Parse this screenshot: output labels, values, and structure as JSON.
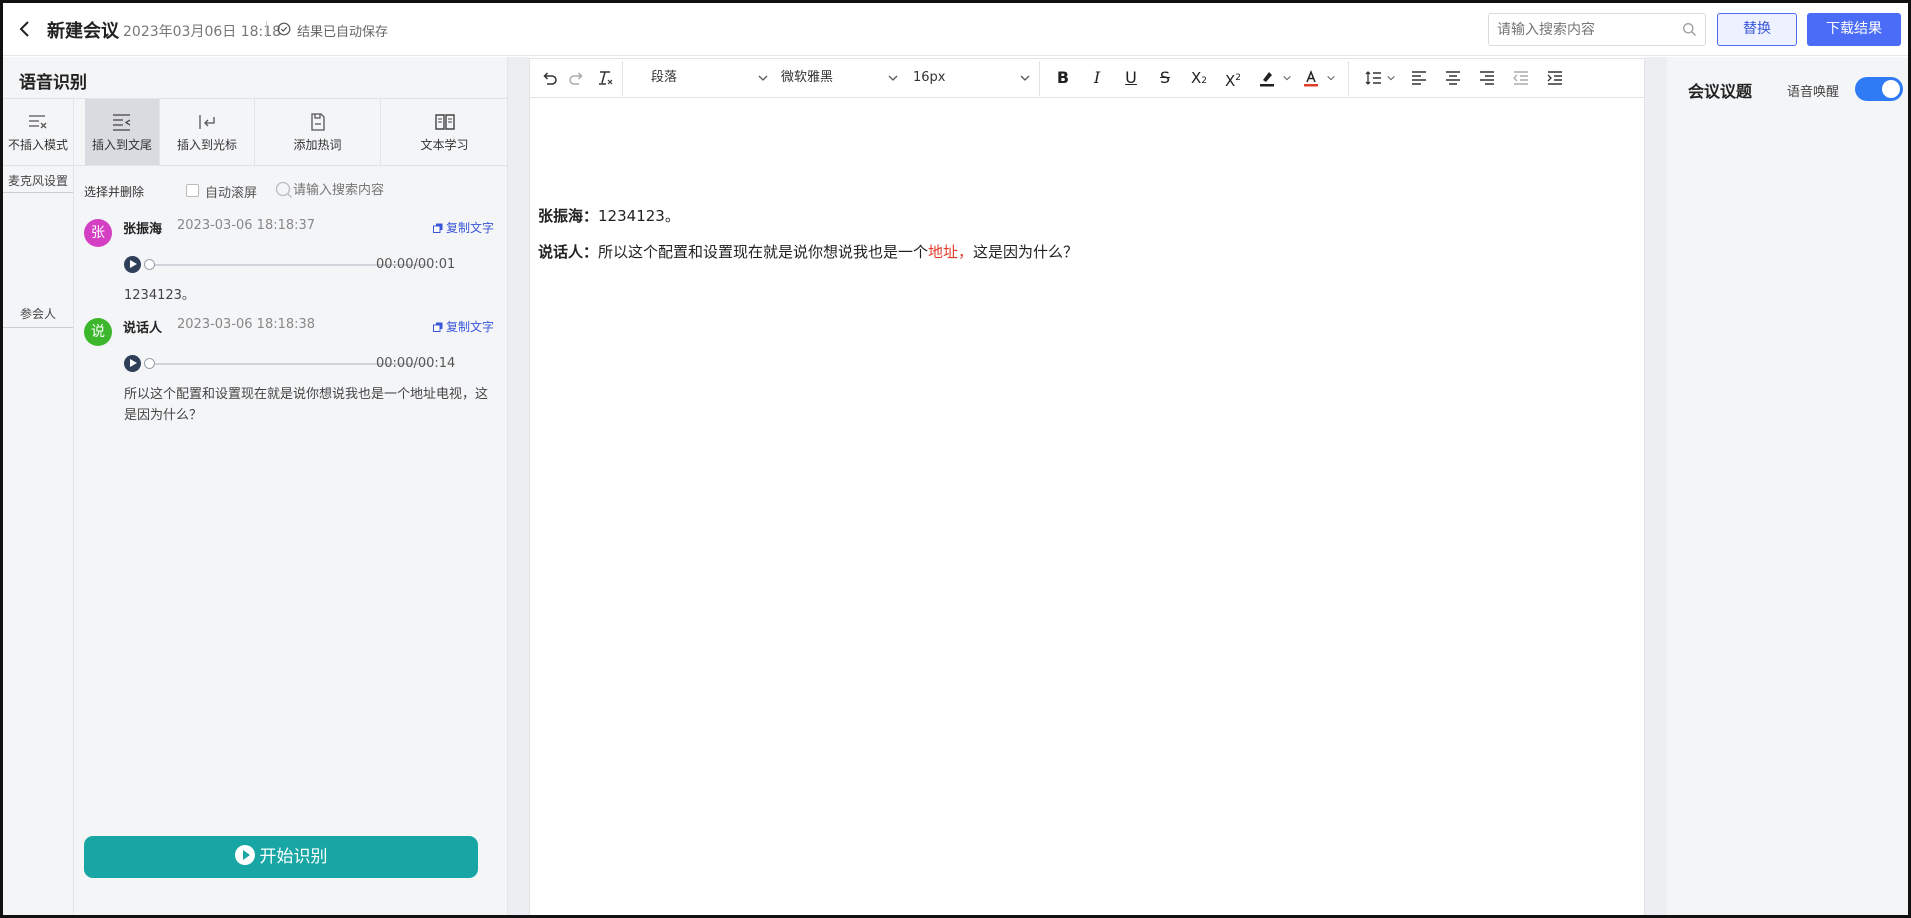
{
  "header": {
    "title": "新建会议",
    "datetime": "2023年03月06日 18:18",
    "saved_status": "结果已自动保存",
    "search_placeholder": "请输入搜索内容",
    "replace_label": "替换",
    "download_label": "下载结果"
  },
  "left_panel": {
    "title": "语音识别",
    "modes": [
      {
        "label": "不插入模式",
        "icon": "no-insert-icon",
        "active": false
      },
      {
        "label": "插入到文尾",
        "icon": "insert-end-icon",
        "active": true
      },
      {
        "label": "插入到光标",
        "icon": "insert-cursor-icon",
        "active": false
      },
      {
        "label": "添加热词",
        "icon": "save-icon",
        "active": false
      },
      {
        "label": "文本学习",
        "icon": "book-icon",
        "active": false
      }
    ],
    "side_tabs": [
      "麦克风设置",
      "参会人"
    ],
    "select_delete": "选择并删除",
    "auto_scroll": "自动滚屏",
    "search_placeholder": "请输入搜索内容",
    "copy_label": "复制文字",
    "messages": [
      {
        "avatar": "张",
        "avatar_color": "#d43fc4",
        "speaker": "张振海",
        "time": "2023-03-06 18:18:37",
        "duration": "00:00/00:01",
        "text": "1234123。"
      },
      {
        "avatar": "说",
        "avatar_color": "#3cb62a",
        "speaker": "说话人",
        "time": "2023-03-06 18:18:38",
        "duration": "00:00/00:14",
        "text": "所以这个配置和设置现在就是说你想说我也是一个地址电视，这是因为什么？"
      }
    ],
    "start_label": "开始识别"
  },
  "editor": {
    "toolbar": {
      "block": "段落",
      "font": "微软雅黑",
      "size": "16px"
    },
    "lines": [
      {
        "speaker": "张振海：",
        "text": "1234123。"
      },
      {
        "speaker": "说话人：",
        "before": "所以这个配置和设置现在就是说你想说我也是一个",
        "highlight": "地址，",
        "after": "这是因为什么？"
      }
    ]
  },
  "right_panel": {
    "title": "会议议题",
    "wake_label": "语音唤醒",
    "wake_on": true
  },
  "colors": {
    "accent": "#4a6cf7",
    "start_button": "#17a6a4",
    "toggle": "#2f7bf5",
    "highlight_text": "#e03c2b"
  }
}
